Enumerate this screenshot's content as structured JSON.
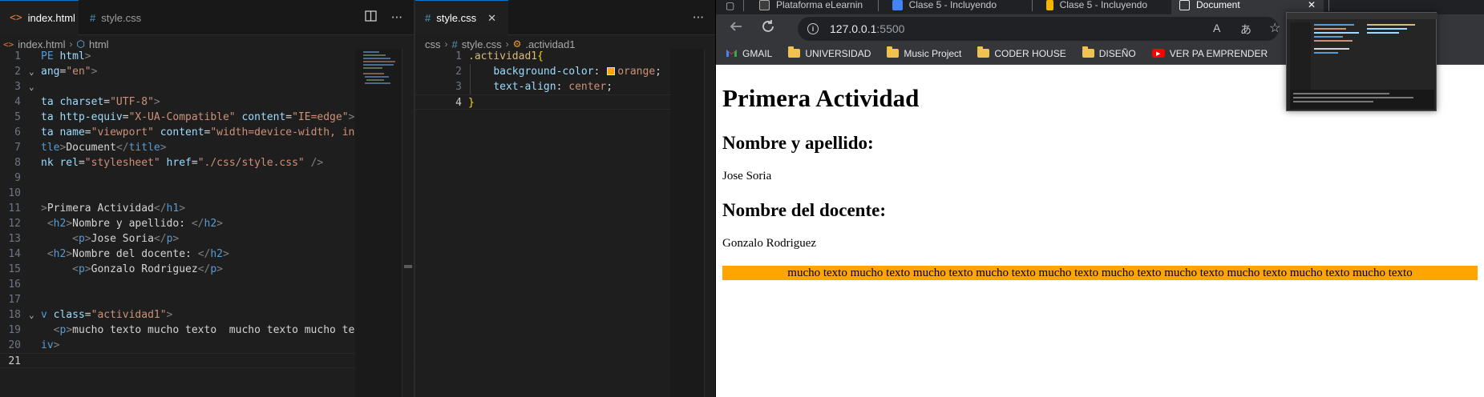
{
  "editor_left": {
    "tabs": [
      {
        "icon": "<>",
        "label": "index.html",
        "active": true
      },
      {
        "icon": "#",
        "label": "style.css",
        "active": false
      }
    ],
    "breadcrumb": [
      "index.html",
      "html"
    ],
    "lines": [
      {
        "n": "1",
        "fold": "",
        "tokens": [
          [
            "c-tag",
            "PE "
          ],
          [
            "c-attr",
            "html"
          ],
          [
            "c-brk",
            ">"
          ]
        ]
      },
      {
        "n": "2",
        "fold": "v",
        "tokens": [
          [
            "c-attr",
            "ang"
          ],
          [
            "c-txt",
            "="
          ],
          [
            "c-str",
            "\"en\""
          ],
          [
            "c-brk",
            ">"
          ]
        ]
      },
      {
        "n": "3",
        "fold": "v",
        "tokens": []
      },
      {
        "n": "4",
        "fold": "",
        "tokens": [
          [
            "c-attr",
            "ta charset"
          ],
          [
            "c-txt",
            "="
          ],
          [
            "c-str",
            "\"UTF-8\""
          ],
          [
            "c-brk",
            ">"
          ]
        ]
      },
      {
        "n": "5",
        "fold": "",
        "tokens": [
          [
            "c-attr",
            "ta http-equiv"
          ],
          [
            "c-txt",
            "="
          ],
          [
            "c-str",
            "\"X-UA-Compatible\""
          ],
          [
            "c-txt",
            " "
          ],
          [
            "c-attr",
            "content"
          ],
          [
            "c-txt",
            "="
          ],
          [
            "c-str",
            "\"IE=edge\""
          ],
          [
            "c-brk",
            ">"
          ]
        ]
      },
      {
        "n": "6",
        "fold": "",
        "tokens": [
          [
            "c-attr",
            "ta name"
          ],
          [
            "c-txt",
            "="
          ],
          [
            "c-str",
            "\"viewport\""
          ],
          [
            "c-txt",
            " "
          ],
          [
            "c-attr",
            "content"
          ],
          [
            "c-txt",
            "="
          ],
          [
            "c-str",
            "\"width=device-width, ini"
          ]
        ]
      },
      {
        "n": "7",
        "fold": "",
        "tokens": [
          [
            "c-tag",
            "tle"
          ],
          [
            "c-brk",
            ">"
          ],
          [
            "c-txt",
            "Document"
          ],
          [
            "c-brk",
            "</"
          ],
          [
            "c-tag",
            "title"
          ],
          [
            "c-brk",
            ">"
          ]
        ]
      },
      {
        "n": "8",
        "fold": "",
        "tokens": [
          [
            "c-attr",
            "nk rel"
          ],
          [
            "c-txt",
            "="
          ],
          [
            "c-str",
            "\"stylesheet\""
          ],
          [
            "c-txt",
            " "
          ],
          [
            "c-attr",
            "href"
          ],
          [
            "c-txt",
            "="
          ],
          [
            "c-str",
            "\"./css/style.css\""
          ],
          [
            "c-txt",
            " "
          ],
          [
            "c-brk",
            "/>"
          ]
        ]
      },
      {
        "n": "9",
        "fold": "",
        "tokens": []
      },
      {
        "n": "10",
        "fold": "",
        "tokens": []
      },
      {
        "n": "11",
        "fold": "",
        "tokens": [
          [
            "c-brk",
            ">"
          ],
          [
            "c-txt",
            "Primera Actividad"
          ],
          [
            "c-brk",
            "</"
          ],
          [
            "c-tag",
            "h1"
          ],
          [
            "c-brk",
            ">"
          ]
        ]
      },
      {
        "n": "12",
        "fold": "",
        "tokens": [
          [
            "c-txt",
            " "
          ],
          [
            "c-brk",
            "<"
          ],
          [
            "c-tag",
            "h2"
          ],
          [
            "c-brk",
            ">"
          ],
          [
            "c-txt",
            "Nombre y apellido: "
          ],
          [
            "c-brk",
            "</"
          ],
          [
            "c-tag",
            "h2"
          ],
          [
            "c-brk",
            ">"
          ]
        ]
      },
      {
        "n": "13",
        "fold": "",
        "tokens": [
          [
            "c-txt",
            "     "
          ],
          [
            "c-brk",
            "<"
          ],
          [
            "c-tag",
            "p"
          ],
          [
            "c-brk",
            ">"
          ],
          [
            "c-txt",
            "Jose Soria"
          ],
          [
            "c-brk",
            "</"
          ],
          [
            "c-tag",
            "p"
          ],
          [
            "c-brk",
            ">"
          ]
        ]
      },
      {
        "n": "14",
        "fold": "",
        "tokens": [
          [
            "c-txt",
            " "
          ],
          [
            "c-brk",
            "<"
          ],
          [
            "c-tag",
            "h2"
          ],
          [
            "c-brk",
            ">"
          ],
          [
            "c-txt",
            "Nombre del docente: "
          ],
          [
            "c-brk",
            "</"
          ],
          [
            "c-tag",
            "h2"
          ],
          [
            "c-brk",
            ">"
          ]
        ]
      },
      {
        "n": "15",
        "fold": "",
        "tokens": [
          [
            "c-txt",
            "     "
          ],
          [
            "c-brk",
            "<"
          ],
          [
            "c-tag",
            "p"
          ],
          [
            "c-brk",
            ">"
          ],
          [
            "c-txt",
            "Gonzalo Rodriguez"
          ],
          [
            "c-brk",
            "</"
          ],
          [
            "c-tag",
            "p"
          ],
          [
            "c-brk",
            ">"
          ]
        ]
      },
      {
        "n": "16",
        "fold": "",
        "tokens": []
      },
      {
        "n": "17",
        "fold": "",
        "tokens": []
      },
      {
        "n": "18",
        "fold": "v",
        "tokens": [
          [
            "c-tag",
            "v"
          ],
          [
            "c-txt",
            " "
          ],
          [
            "c-attr",
            "class"
          ],
          [
            "c-txt",
            "="
          ],
          [
            "c-str",
            "\"actividad1\""
          ],
          [
            "c-brk",
            ">"
          ]
        ]
      },
      {
        "n": "19",
        "fold": "",
        "tokens": [
          [
            "c-txt",
            "  "
          ],
          [
            "c-brk",
            "<"
          ],
          [
            "c-tag",
            "p"
          ],
          [
            "c-brk",
            ">"
          ],
          [
            "c-txt",
            "mucho texto mucho texto  mucho texto mucho tex"
          ]
        ]
      },
      {
        "n": "20",
        "fold": "",
        "tokens": [
          [
            "c-tag",
            "iv"
          ],
          [
            "c-brk",
            ">"
          ]
        ]
      },
      {
        "n": "21",
        "fold": "",
        "tokens": [],
        "current": true
      }
    ]
  },
  "editor_right": {
    "tabs": [
      {
        "icon": "#",
        "label": "style.css",
        "active": true
      }
    ],
    "breadcrumb": [
      "css",
      "style.css",
      ".actividad1"
    ],
    "lines": [
      {
        "n": "1",
        "tokens": [
          [
            "c-sel",
            ".actividad1"
          ],
          [
            "c-brace",
            "{"
          ]
        ]
      },
      {
        "n": "2",
        "tokens": [
          [
            "c-txt",
            "    "
          ],
          [
            "c-prop",
            "background-color"
          ],
          [
            "c-txt",
            ": "
          ],
          [
            "swatch",
            "orange"
          ],
          [
            "c-val",
            "orange"
          ],
          [
            "c-txt",
            ";"
          ]
        ]
      },
      {
        "n": "3",
        "tokens": [
          [
            "c-txt",
            "    "
          ],
          [
            "c-prop",
            "text-align"
          ],
          [
            "c-txt",
            ": "
          ],
          [
            "c-val",
            "center"
          ],
          [
            "c-txt",
            ";"
          ]
        ]
      },
      {
        "n": "4",
        "tokens": [
          [
            "c-brace",
            "}"
          ]
        ],
        "current": true
      }
    ]
  },
  "browser": {
    "tabs": [
      {
        "label": "Plataforma eLearnin",
        "favicon": "#3c3c3c"
      },
      {
        "label": "Clase 5 - Incluyendo",
        "favicon": "#4285f4"
      },
      {
        "label": "Clase 5 - Incluyendo",
        "favicon": "#f4b400"
      },
      {
        "label": "Document",
        "favicon": "#ffffff",
        "active": true
      }
    ],
    "close_glyph": "✕",
    "address": {
      "host": "127.0.0.1",
      "port": ":5500"
    },
    "toolbar_icons": [
      "A",
      "あ",
      "☆"
    ],
    "bookmarks": [
      {
        "label": "GMAIL",
        "icon": "gmail-icon"
      },
      {
        "label": "UNIVERSIDAD",
        "icon": "folder-icon"
      },
      {
        "label": "Music Project",
        "icon": "folder-icon"
      },
      {
        "label": "CODER HOUSE",
        "icon": "folder-icon"
      },
      {
        "label": "DISEÑO",
        "icon": "folder-icon"
      },
      {
        "label": "VER PA EMPRENDER",
        "icon": "youtube-icon"
      }
    ],
    "page": {
      "h1": "Primera Actividad",
      "h2_name": "Nombre y apellido:",
      "p_name": "Jose Soria",
      "h2_teacher": "Nombre del docente:",
      "p_teacher": "Gonzalo Rodriguez",
      "actividad_text": "mucho texto mucho texto mucho texto mucho texto mucho texto mucho texto mucho texto mucho texto mucho texto mucho texto",
      "actividad_bg": "#ffa500"
    }
  }
}
